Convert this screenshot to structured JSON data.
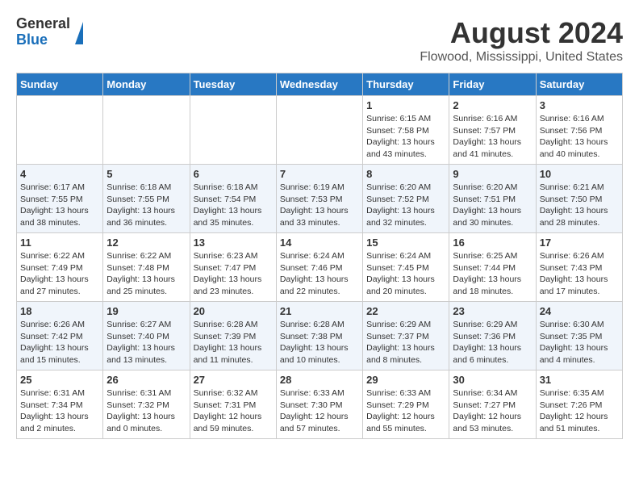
{
  "logo": {
    "general": "General",
    "blue": "Blue"
  },
  "title": "August 2024",
  "subtitle": "Flowood, Mississippi, United States",
  "weekdays": [
    "Sunday",
    "Monday",
    "Tuesday",
    "Wednesday",
    "Thursday",
    "Friday",
    "Saturday"
  ],
  "weeks": [
    [
      {
        "day": "",
        "info": ""
      },
      {
        "day": "",
        "info": ""
      },
      {
        "day": "",
        "info": ""
      },
      {
        "day": "",
        "info": ""
      },
      {
        "day": "1",
        "info": "Sunrise: 6:15 AM\nSunset: 7:58 PM\nDaylight: 13 hours\nand 43 minutes."
      },
      {
        "day": "2",
        "info": "Sunrise: 6:16 AM\nSunset: 7:57 PM\nDaylight: 13 hours\nand 41 minutes."
      },
      {
        "day": "3",
        "info": "Sunrise: 6:16 AM\nSunset: 7:56 PM\nDaylight: 13 hours\nand 40 minutes."
      }
    ],
    [
      {
        "day": "4",
        "info": "Sunrise: 6:17 AM\nSunset: 7:55 PM\nDaylight: 13 hours\nand 38 minutes."
      },
      {
        "day": "5",
        "info": "Sunrise: 6:18 AM\nSunset: 7:55 PM\nDaylight: 13 hours\nand 36 minutes."
      },
      {
        "day": "6",
        "info": "Sunrise: 6:18 AM\nSunset: 7:54 PM\nDaylight: 13 hours\nand 35 minutes."
      },
      {
        "day": "7",
        "info": "Sunrise: 6:19 AM\nSunset: 7:53 PM\nDaylight: 13 hours\nand 33 minutes."
      },
      {
        "day": "8",
        "info": "Sunrise: 6:20 AM\nSunset: 7:52 PM\nDaylight: 13 hours\nand 32 minutes."
      },
      {
        "day": "9",
        "info": "Sunrise: 6:20 AM\nSunset: 7:51 PM\nDaylight: 13 hours\nand 30 minutes."
      },
      {
        "day": "10",
        "info": "Sunrise: 6:21 AM\nSunset: 7:50 PM\nDaylight: 13 hours\nand 28 minutes."
      }
    ],
    [
      {
        "day": "11",
        "info": "Sunrise: 6:22 AM\nSunset: 7:49 PM\nDaylight: 13 hours\nand 27 minutes."
      },
      {
        "day": "12",
        "info": "Sunrise: 6:22 AM\nSunset: 7:48 PM\nDaylight: 13 hours\nand 25 minutes."
      },
      {
        "day": "13",
        "info": "Sunrise: 6:23 AM\nSunset: 7:47 PM\nDaylight: 13 hours\nand 23 minutes."
      },
      {
        "day": "14",
        "info": "Sunrise: 6:24 AM\nSunset: 7:46 PM\nDaylight: 13 hours\nand 22 minutes."
      },
      {
        "day": "15",
        "info": "Sunrise: 6:24 AM\nSunset: 7:45 PM\nDaylight: 13 hours\nand 20 minutes."
      },
      {
        "day": "16",
        "info": "Sunrise: 6:25 AM\nSunset: 7:44 PM\nDaylight: 13 hours\nand 18 minutes."
      },
      {
        "day": "17",
        "info": "Sunrise: 6:26 AM\nSunset: 7:43 PM\nDaylight: 13 hours\nand 17 minutes."
      }
    ],
    [
      {
        "day": "18",
        "info": "Sunrise: 6:26 AM\nSunset: 7:42 PM\nDaylight: 13 hours\nand 15 minutes."
      },
      {
        "day": "19",
        "info": "Sunrise: 6:27 AM\nSunset: 7:40 PM\nDaylight: 13 hours\nand 13 minutes."
      },
      {
        "day": "20",
        "info": "Sunrise: 6:28 AM\nSunset: 7:39 PM\nDaylight: 13 hours\nand 11 minutes."
      },
      {
        "day": "21",
        "info": "Sunrise: 6:28 AM\nSunset: 7:38 PM\nDaylight: 13 hours\nand 10 minutes."
      },
      {
        "day": "22",
        "info": "Sunrise: 6:29 AM\nSunset: 7:37 PM\nDaylight: 13 hours\nand 8 minutes."
      },
      {
        "day": "23",
        "info": "Sunrise: 6:29 AM\nSunset: 7:36 PM\nDaylight: 13 hours\nand 6 minutes."
      },
      {
        "day": "24",
        "info": "Sunrise: 6:30 AM\nSunset: 7:35 PM\nDaylight: 13 hours\nand 4 minutes."
      }
    ],
    [
      {
        "day": "25",
        "info": "Sunrise: 6:31 AM\nSunset: 7:34 PM\nDaylight: 13 hours\nand 2 minutes."
      },
      {
        "day": "26",
        "info": "Sunrise: 6:31 AM\nSunset: 7:32 PM\nDaylight: 13 hours\nand 0 minutes."
      },
      {
        "day": "27",
        "info": "Sunrise: 6:32 AM\nSunset: 7:31 PM\nDaylight: 12 hours\nand 59 minutes."
      },
      {
        "day": "28",
        "info": "Sunrise: 6:33 AM\nSunset: 7:30 PM\nDaylight: 12 hours\nand 57 minutes."
      },
      {
        "day": "29",
        "info": "Sunrise: 6:33 AM\nSunset: 7:29 PM\nDaylight: 12 hours\nand 55 minutes."
      },
      {
        "day": "30",
        "info": "Sunrise: 6:34 AM\nSunset: 7:27 PM\nDaylight: 12 hours\nand 53 minutes."
      },
      {
        "day": "31",
        "info": "Sunrise: 6:35 AM\nSunset: 7:26 PM\nDaylight: 12 hours\nand 51 minutes."
      }
    ]
  ]
}
